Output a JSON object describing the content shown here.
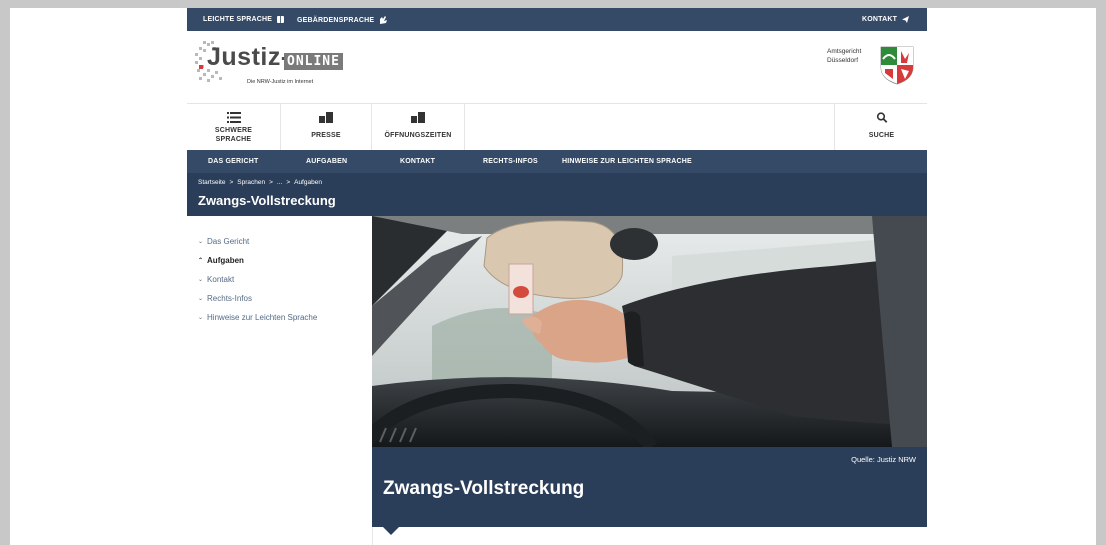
{
  "topbar": {
    "leichte_sprache": "LEICHTE SPRACHE",
    "gebaerdensprache": "GEBÄRDENSPRACHE",
    "kontakt": "KONTAKT"
  },
  "header": {
    "logo_justiz": "Justiz-",
    "logo_online": "ONLINE",
    "logo_tagline": "Die NRW-Justiz im Internet",
    "court_line1": "Amtsgericht",
    "court_line2": "Düsseldorf"
  },
  "service_nav": {
    "schwere_line1": "SCHWERE",
    "schwere_line2": "SPRACHE",
    "presse": "PRESSE",
    "oeffnungszeiten": "ÖFFNUNGSZEITEN",
    "suche": "SUCHE"
  },
  "main_nav": [
    "DAS GERICHT",
    "AUFGABEN",
    "KONTAKT",
    "RECHTS-INFOS",
    "HINWEISE ZUR LEICHTEN SPRACHE"
  ],
  "breadcrumb": {
    "items": [
      "Startseite",
      ">",
      "Sprachen",
      ">",
      "...",
      ">",
      "Aufgaben"
    ]
  },
  "page_title": "Zwangs-Vollstreckung",
  "sidebar": {
    "items": [
      {
        "label": "Das Gericht",
        "chevron": "⌄"
      },
      {
        "label": "Aufgaben",
        "chevron": "⌃"
      },
      {
        "label": "Kontakt",
        "chevron": "⌄"
      },
      {
        "label": "Rechts-Infos",
        "chevron": "⌄"
      },
      {
        "label": "Hinweise zur Leichten Sprache",
        "chevron": "⌄"
      }
    ]
  },
  "hero": {
    "source": "Quelle: Justiz NRW",
    "title": "Zwangs-Vollstreckung"
  },
  "colors": {
    "nav_dark": "#354a66",
    "band_dark": "#2b3e59",
    "sidebar_link": "#546a86",
    "page_bg": "#c8c8c8"
  }
}
